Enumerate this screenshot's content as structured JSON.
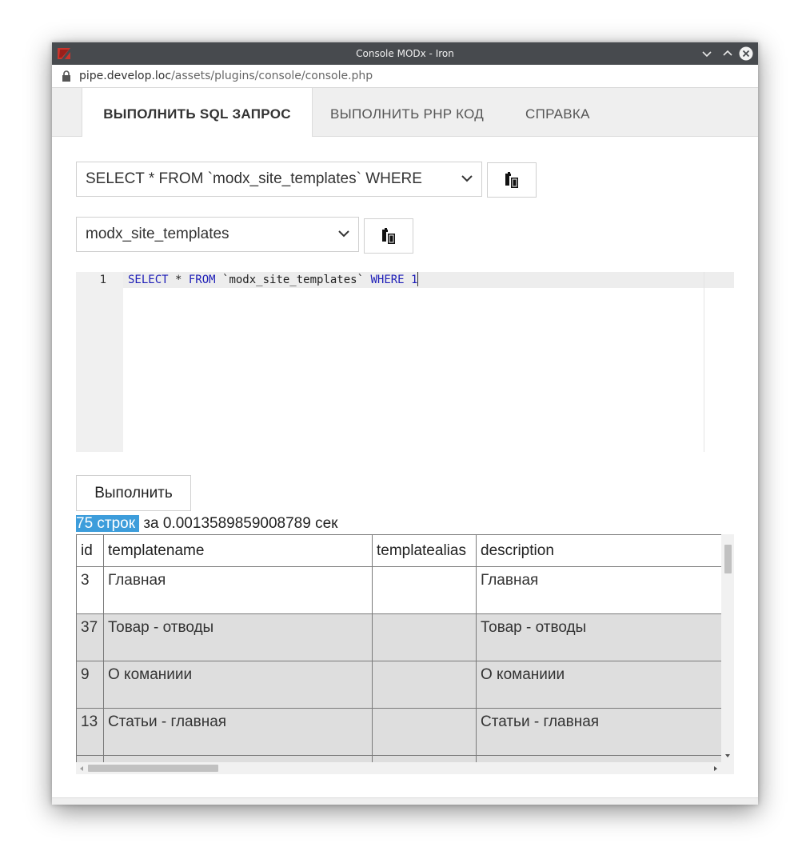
{
  "window": {
    "title": "Console MODx - Iron"
  },
  "address": {
    "host": "pipe.develop.loc",
    "path": "/assets/plugins/console/console.php"
  },
  "tabs": [
    {
      "label": "ВЫПОЛНИТЬ SQL ЗАПРОС",
      "active": true
    },
    {
      "label": "ВЫПОЛНИТЬ PHP КОД",
      "active": false
    },
    {
      "label": "СПРАВКА",
      "active": false
    }
  ],
  "query_select": {
    "value": "SELECT * FROM `modx_site_templates` WHERE"
  },
  "table_select": {
    "value": "modx_site_templates"
  },
  "editor": {
    "line_number": "1",
    "tokens": [
      "SELECT",
      " * ",
      "FROM",
      " `modx_site_templates` ",
      "WHERE",
      " 1"
    ]
  },
  "run_button": {
    "label": "Выполнить"
  },
  "stats": {
    "rows": "75 строк",
    "time": " за 0.0013589859008789 сек"
  },
  "results": {
    "columns": [
      "id",
      "templatename",
      "templatealias",
      "description"
    ],
    "rows": [
      [
        "3",
        "Главная",
        "",
        "Главная"
      ],
      [
        "37",
        "Товар - отводы",
        "",
        "Товар - отводы"
      ],
      [
        "9",
        "О команиии",
        "",
        "О команиии"
      ],
      [
        "13",
        "Статьи - главная",
        "",
        "Статьи - главная"
      ],
      [
        "",
        "",
        "",
        ""
      ]
    ]
  },
  "icons": {
    "app": "app-logo-icon",
    "lock": "lock-icon",
    "minimize": "chevron-down-icon",
    "maximize": "chevron-up-icon",
    "close": "close-icon",
    "paste": "clipboard-icon",
    "dropdown": "chevron-down-icon"
  },
  "colors": {
    "titlebar": "#474a4e",
    "highlight": "#3d9ddb",
    "keyword": "#1f1fb8",
    "alt_row": "#dedede"
  }
}
